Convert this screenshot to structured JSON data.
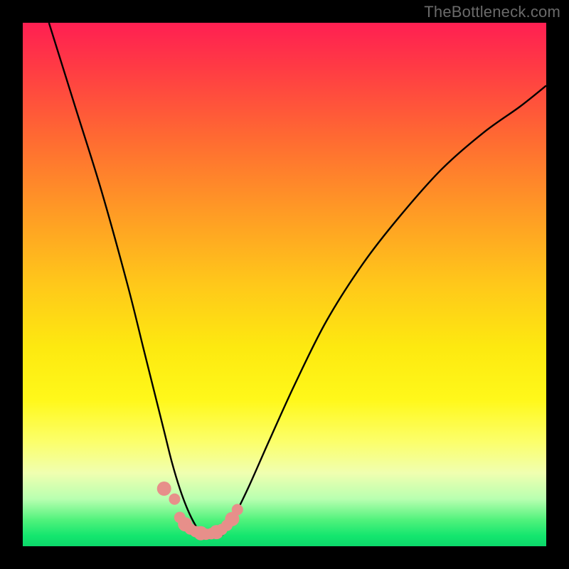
{
  "watermark": "TheBottleneck.com",
  "chart_data": {
    "type": "line",
    "title": "",
    "xlabel": "",
    "ylabel": "",
    "xlim": [
      0,
      100
    ],
    "ylim": [
      0,
      100
    ],
    "grid": false,
    "legend": false,
    "series": [
      {
        "name": "left-curve",
        "x": [
          5,
          10,
          15,
          20,
          23,
          25,
          27,
          28.5,
          30,
          31.5,
          33,
          34.5
        ],
        "values": [
          100,
          84,
          68,
          50,
          38,
          30,
          22,
          16,
          11,
          7,
          4,
          2
        ]
      },
      {
        "name": "right-curve",
        "x": [
          38,
          40,
          43,
          47,
          52,
          58,
          65,
          72,
          80,
          88,
          95,
          100
        ],
        "values": [
          2,
          5,
          11,
          20,
          31,
          43,
          54,
          63,
          72,
          79,
          84,
          88
        ]
      },
      {
        "name": "bottom-dots",
        "x": [
          27,
          29,
          30,
          31,
          32,
          33,
          34,
          35,
          36,
          37,
          38,
          39,
          40,
          41
        ],
        "values": [
          11,
          9,
          5.5,
          4.2,
          3.3,
          2.8,
          2.5,
          2.3,
          2.4,
          2.7,
          3.2,
          4.0,
          5.2,
          7.0
        ]
      }
    ]
  },
  "colors": {
    "curve": "#000000",
    "dots": "#e78f8a"
  }
}
